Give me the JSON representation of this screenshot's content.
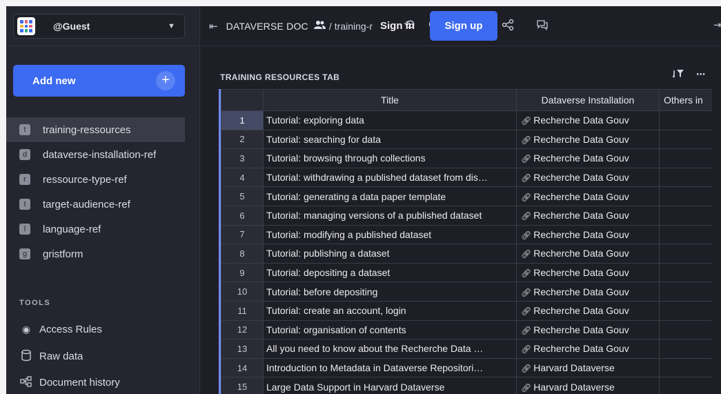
{
  "org": {
    "name": "@Guest"
  },
  "sidebar": {
    "add_new_label": "Add new",
    "pages": [
      {
        "badge": "t",
        "label": "training-ressources",
        "active": true
      },
      {
        "badge": "d",
        "label": "dataverse-installation-ref"
      },
      {
        "badge": "r",
        "label": "ressource-type-ref"
      },
      {
        "badge": "t",
        "label": "target-audience-ref"
      },
      {
        "badge": "l",
        "label": "language-ref"
      },
      {
        "badge": "g",
        "label": "gristform"
      }
    ],
    "tools_title": "TOOLS",
    "tools": [
      {
        "icon": "eye-icon",
        "label": "Access Rules"
      },
      {
        "icon": "database-icon",
        "label": "Raw data"
      },
      {
        "icon": "history-icon",
        "label": "Document history"
      }
    ]
  },
  "header": {
    "doc_title": "DATAVERSE DOC",
    "crumb_separator": "/",
    "page_crumb": "training-r",
    "sign_in": "Sign in",
    "sign_up": "Sign up"
  },
  "widget": {
    "title": "TRAINING RESOURCES TAB",
    "columns": [
      "Title",
      "Dataverse Installation",
      "Others in"
    ],
    "rows": [
      {
        "n": "1",
        "title": "Tutorial: exploring data",
        "installation": "Recherche Data Gouv"
      },
      {
        "n": "2",
        "title": "Tutorial: searching for data",
        "installation": "Recherche Data Gouv"
      },
      {
        "n": "3",
        "title": "Tutorial: browsing through collections",
        "installation": "Recherche Data Gouv"
      },
      {
        "n": "4",
        "title": "Tutorial: withdrawing a published dataset from dis…",
        "installation": "Recherche Data Gouv"
      },
      {
        "n": "5",
        "title": "Tutorial: generating a data paper template",
        "installation": "Recherche Data Gouv"
      },
      {
        "n": "6",
        "title": "Tutorial: managing versions of a published dataset",
        "installation": "Recherche Data Gouv"
      },
      {
        "n": "7",
        "title": "Tutorial: modifying a published dataset",
        "installation": "Recherche Data Gouv"
      },
      {
        "n": "8",
        "title": "Tutorial: publishing a dataset",
        "installation": "Recherche Data Gouv"
      },
      {
        "n": "9",
        "title": "Tutorial: depositing a dataset",
        "installation": "Recherche Data Gouv"
      },
      {
        "n": "10",
        "title": "Tutorial: before depositing",
        "installation": "Recherche Data Gouv"
      },
      {
        "n": "11",
        "title": "Tutorial: create an account, login",
        "installation": "Recherche Data Gouv"
      },
      {
        "n": "12",
        "title": "Tutorial: organisation of contents",
        "installation": "Recherche Data Gouv"
      },
      {
        "n": "13",
        "title": "All you need to know about the Recherche Data …",
        "installation": "Recherche Data Gouv"
      },
      {
        "n": "14",
        "title": "Introduction to Metadata in Dataverse Repositori…",
        "installation": "Harvard Dataverse"
      },
      {
        "n": "15",
        "title": "Large Data Support in Harvard Dataverse",
        "installation": "Harvard Dataverse"
      }
    ]
  },
  "colors": {
    "accent": "#3c6af0",
    "background": "#1e1e26",
    "sidebar": "#25252f"
  }
}
